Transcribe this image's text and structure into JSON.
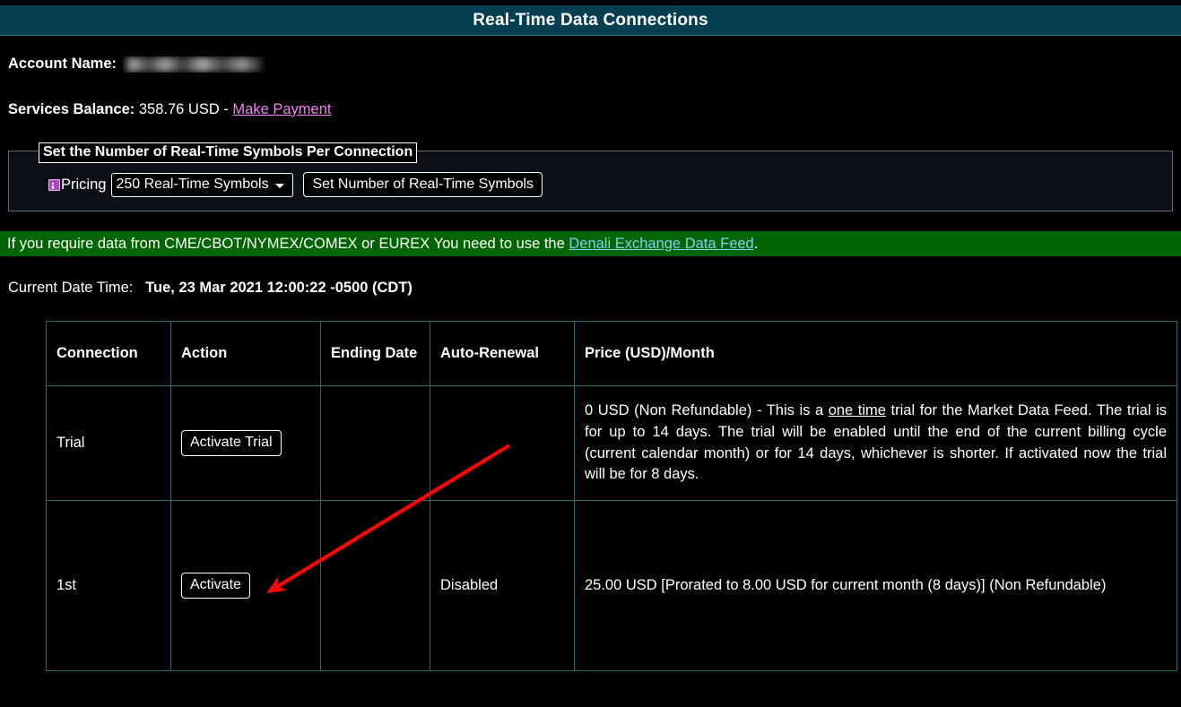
{
  "header": {
    "title": "Real-Time Data Connections",
    "bar_color": "#063f52"
  },
  "account": {
    "name_label": "Account Name:",
    "name_value": "",
    "balance_label": "Services Balance:",
    "balance_value": "358.76 USD -",
    "make_payment_link": "Make Payment",
    "link_color": "#ee82ee"
  },
  "pricing_panel": {
    "legend": "Set the Number of Real-Time Symbols Per Connection",
    "info_icon": "info-icon",
    "pricing_label": "Pricing",
    "selected_option": "250 Real-Time Symbols",
    "options": [
      "250 Real-Time Symbols"
    ],
    "set_button": "Set Number of Real-Time Symbols"
  },
  "notice": {
    "text_before": "If you require data from CME/CBOT/NYMEX/COMEX or EUREX You need to use the",
    "link": "Denali Exchange Data Feed",
    "text_after": ".",
    "background": "#006400",
    "link_color": "#7fd4ee"
  },
  "current_datetime": {
    "label": "Current Date Time:",
    "value": "Tue, 23 Mar 2021 12:00:22 -0500 (CDT)"
  },
  "table": {
    "columns": [
      "Connection",
      "Action",
      "Ending Date",
      "Auto-Renewal",
      "Price (USD)/Month"
    ],
    "rows": [
      {
        "connection": "Trial",
        "action_button": "Activate Trial",
        "ending_date": "",
        "auto_renewal": "",
        "price_part1": "0 USD (Non Refundable) - This is a ",
        "price_underlined": "one time",
        "price_part2": " trial for the Market Data Feed. The trial is for up to 14 days. The trial will be enabled until the end of the current billing cycle (current calendar month) or for 14 days, whichever is shorter. If activated now the trial will be for 8 days."
      },
      {
        "connection": "1st",
        "action_button": "Activate",
        "ending_date": "",
        "auto_renewal": "Disabled",
        "price_part1": "25.00 USD [Prorated to 8.00 USD for current month (8 days)] (Non Refundable)",
        "price_underlined": "",
        "price_part2": ""
      }
    ],
    "border_color": "#2e6670"
  },
  "annotation": {
    "arrow_color": "#fb0505",
    "arrow_from": "568,497",
    "arrow_to": "298,661"
  }
}
